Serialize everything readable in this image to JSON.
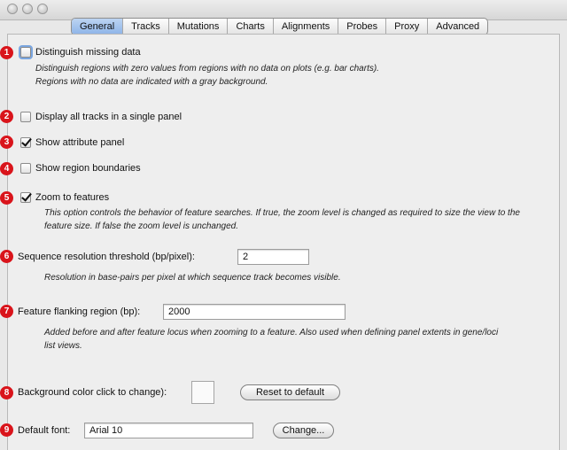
{
  "tabs": [
    "General",
    "Tracks",
    "Mutations",
    "Charts",
    "Alignments",
    "Probes",
    "Proxy",
    "Advanced"
  ],
  "active_tab": "General",
  "colors": {
    "badge": "#d9141b",
    "active_tab": "#9dbfee"
  },
  "settings": {
    "s1": {
      "badge": "1",
      "label": "Distinguish missing data",
      "checked": false,
      "description": "Distinguish regions with zero values from regions with no data on plots (e.g. bar charts). Regions with no data are indicated with a gray background."
    },
    "s2": {
      "badge": "2",
      "label": "Display all tracks in a single panel",
      "checked": false
    },
    "s3": {
      "badge": "3",
      "label": "Show attribute panel",
      "checked": true
    },
    "s4": {
      "badge": "4",
      "label": "Show region boundaries",
      "checked": false
    },
    "s5": {
      "badge": "5",
      "label": "Zoom to features",
      "checked": true,
      "description": "This option controls the behavior of feature searches. If true, the zoom level is changed as required to size the view to the feature size. If false the zoom level is unchanged."
    },
    "s6": {
      "badge": "6",
      "label": "Sequence resolution threshold (bp/pixel):",
      "value": "2",
      "description": "Resolution in base-pairs per pixel at which sequence track becomes visible."
    },
    "s7": {
      "badge": "7",
      "label": "Feature flanking region (bp):",
      "value": "2000",
      "description": "Added before and after feature locus when zooming to a feature. Also used when defining panel extents in gene/loci list views."
    },
    "s8": {
      "badge": "8",
      "label": "Background color click to change):",
      "button": "Reset to default"
    },
    "s9": {
      "badge": "9",
      "label": "Default font:",
      "value": "Arial 10",
      "button": "Change..."
    }
  }
}
